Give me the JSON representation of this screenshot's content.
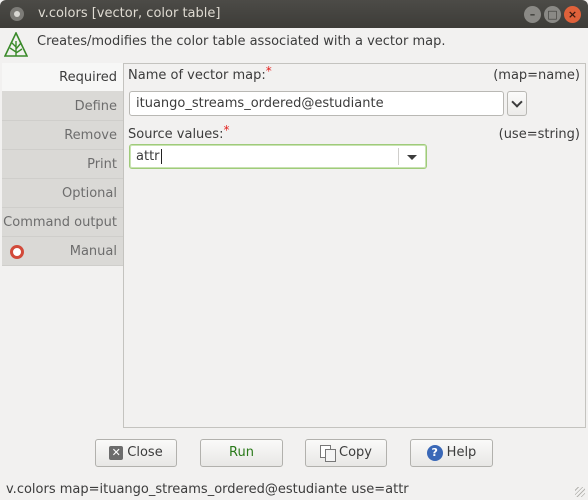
{
  "window": {
    "title": "v.colors [vector, color table]",
    "controls": [
      "minimize",
      "maximize",
      "close"
    ]
  },
  "description": "Creates/modifies the color table associated with a vector map.",
  "tabs": [
    {
      "label": "Required",
      "active": true
    },
    {
      "label": "Define",
      "active": false
    },
    {
      "label": "Remove",
      "active": false
    },
    {
      "label": "Print",
      "active": false
    },
    {
      "label": "Optional",
      "active": false
    },
    {
      "label": "Command output",
      "active": false
    },
    {
      "label": "Manual",
      "active": false,
      "icon": "lifebuoy-icon"
    }
  ],
  "fields": {
    "map": {
      "label": "Name of vector map:",
      "required_mark": "*",
      "hint": "(map=name)",
      "value": "ituango_streams_ordered@estudiante"
    },
    "source": {
      "label": "Source values:",
      "required_mark": "*",
      "hint": "(use=string)",
      "value": "attr"
    }
  },
  "buttons": {
    "close": {
      "label": "Close",
      "icon": "close-x-icon"
    },
    "run": {
      "label": "Run"
    },
    "copy": {
      "label": "Copy",
      "icon": "copy-icon"
    },
    "help": {
      "label": "Help",
      "icon": "help-icon"
    }
  },
  "status_text": "v.colors map=ituango_streams_ordered@estudiante use=attr",
  "colors": {
    "titlebar": "#3f3e3a",
    "required_mark": "#e3201d",
    "focus_border": "#9fcb7a",
    "run_text": "#2a7a1a",
    "help_icon": "#3a68b7"
  }
}
